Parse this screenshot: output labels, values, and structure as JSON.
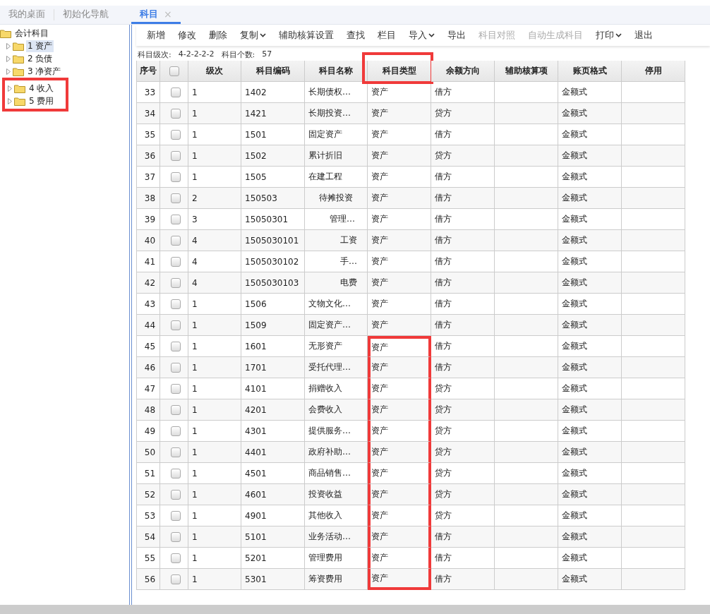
{
  "tabs": [
    {
      "label": "我的桌面",
      "selected": false
    },
    {
      "label": "初始化导航",
      "selected": false
    },
    {
      "label": "科目",
      "selected": true,
      "close": "×"
    }
  ],
  "sidebar": {
    "root": {
      "label": "会计科目",
      "children": [
        {
          "label": "1 资产",
          "selected": true,
          "highlighted": false
        },
        {
          "label": "2 负债",
          "selected": false,
          "highlighted": false
        },
        {
          "label": "3 净资产",
          "selected": false,
          "highlighted": false
        },
        {
          "label": "4 收入",
          "selected": false,
          "highlighted": true
        },
        {
          "label": "5 费用",
          "selected": false,
          "highlighted": true
        }
      ]
    }
  },
  "toolbar": [
    {
      "label": "新增",
      "dropdown": false,
      "disabled": false
    },
    {
      "label": "修改",
      "dropdown": false,
      "disabled": false
    },
    {
      "label": "删除",
      "dropdown": false,
      "disabled": false
    },
    {
      "label": "复制",
      "dropdown": true,
      "disabled": false
    },
    {
      "label": "辅助核算设置",
      "dropdown": false,
      "disabled": false
    },
    {
      "label": "查找",
      "dropdown": false,
      "disabled": false
    },
    {
      "label": "栏目",
      "dropdown": false,
      "disabled": false
    },
    {
      "label": "导入",
      "dropdown": true,
      "disabled": false
    },
    {
      "label": "导出",
      "dropdown": false,
      "disabled": false
    },
    {
      "label": "科目对照",
      "dropdown": false,
      "disabled": true
    },
    {
      "label": "自动生成科目",
      "dropdown": false,
      "disabled": true
    },
    {
      "label": "打印",
      "dropdown": true,
      "disabled": false
    },
    {
      "label": "退出",
      "dropdown": false,
      "disabled": false
    }
  ],
  "info": [
    {
      "label": "科目级次:",
      "value": "4-2-2-2-2"
    },
    {
      "label": "科目个数:",
      "value": "57"
    }
  ],
  "table": {
    "columns": [
      {
        "label": "序号",
        "kind": "index",
        "highlighted": false
      },
      {
        "kind": "check",
        "highlighted": false
      },
      {
        "label": "级次",
        "kind": "text",
        "highlighted": false
      },
      {
        "label": "科目编码",
        "kind": "text",
        "highlighted": false
      },
      {
        "label": "科目名称",
        "kind": "name",
        "highlighted": false
      },
      {
        "label": "科目类型",
        "kind": "text",
        "highlighted": true
      },
      {
        "label": "余额方向",
        "kind": "text",
        "highlighted": false
      },
      {
        "label": "辅助核算项",
        "kind": "text",
        "highlighted": false
      },
      {
        "label": "账页格式",
        "kind": "text",
        "highlighted": false
      },
      {
        "label": "停用",
        "kind": "text",
        "highlighted": false
      }
    ],
    "rows": [
      {
        "no": "33",
        "checked": false,
        "level": "1",
        "code": "1402",
        "name": "长期债权…",
        "type": "资产",
        "direction": "借方",
        "aux": "",
        "format": "金额式",
        "disabled_flag": "",
        "highlighted": false
      },
      {
        "no": "34",
        "checked": false,
        "level": "1",
        "code": "1421",
        "name": "长期投资…",
        "type": "资产",
        "direction": "贷方",
        "aux": "",
        "format": "金额式",
        "disabled_flag": "",
        "highlighted": false
      },
      {
        "no": "35",
        "checked": false,
        "level": "1",
        "code": "1501",
        "name": "固定资产",
        "type": "资产",
        "direction": "借方",
        "aux": "",
        "format": "金额式",
        "disabled_flag": "",
        "highlighted": false
      },
      {
        "no": "36",
        "checked": false,
        "level": "1",
        "code": "1502",
        "name": "累计折旧",
        "type": "资产",
        "direction": "贷方",
        "aux": "",
        "format": "金额式",
        "disabled_flag": "",
        "highlighted": false
      },
      {
        "no": "37",
        "checked": false,
        "level": "1",
        "code": "1505",
        "name": "在建工程",
        "type": "资产",
        "direction": "借方",
        "aux": "",
        "format": "金额式",
        "disabled_flag": "",
        "highlighted": false
      },
      {
        "no": "38",
        "checked": false,
        "level": "2",
        "code": "150503",
        "name": "待摊投资",
        "type": "资产",
        "direction": "借方",
        "aux": "",
        "format": "金额式",
        "disabled_flag": "",
        "highlighted": false
      },
      {
        "no": "39",
        "checked": false,
        "level": "3",
        "code": "15050301",
        "name": "管理…",
        "type": "资产",
        "direction": "借方",
        "aux": "",
        "format": "金额式",
        "disabled_flag": "",
        "highlighted": false
      },
      {
        "no": "40",
        "checked": false,
        "level": "4",
        "code": "1505030101",
        "name": "工资",
        "type": "资产",
        "direction": "借方",
        "aux": "",
        "format": "金额式",
        "disabled_flag": "",
        "highlighted": false
      },
      {
        "no": "41",
        "checked": false,
        "level": "4",
        "code": "1505030102",
        "name": "手…",
        "type": "资产",
        "direction": "借方",
        "aux": "",
        "format": "金额式",
        "disabled_flag": "",
        "highlighted": false
      },
      {
        "no": "42",
        "checked": false,
        "level": "4",
        "code": "1505030103",
        "name": "电费",
        "type": "资产",
        "direction": "借方",
        "aux": "",
        "format": "金额式",
        "disabled_flag": "",
        "highlighted": false
      },
      {
        "no": "43",
        "checked": false,
        "level": "1",
        "code": "1506",
        "name": "文物文化…",
        "type": "资产",
        "direction": "借方",
        "aux": "",
        "format": "金额式",
        "disabled_flag": "",
        "highlighted": false
      },
      {
        "no": "44",
        "checked": false,
        "level": "1",
        "code": "1509",
        "name": "固定资产…",
        "type": "资产",
        "direction": "借方",
        "aux": "",
        "format": "金额式",
        "disabled_flag": "",
        "highlighted": false
      },
      {
        "no": "45",
        "checked": false,
        "level": "1",
        "code": "1601",
        "name": "无形资产",
        "type": "资产",
        "direction": "借方",
        "aux": "",
        "format": "金额式",
        "disabled_flag": "",
        "highlighted": true
      },
      {
        "no": "46",
        "checked": false,
        "level": "1",
        "code": "1701",
        "name": "受托代理…",
        "type": "资产",
        "direction": "借方",
        "aux": "",
        "format": "金额式",
        "disabled_flag": "",
        "highlighted": true
      },
      {
        "no": "47",
        "checked": false,
        "level": "1",
        "code": "4101",
        "name": "捐赠收入",
        "type": "资产",
        "direction": "贷方",
        "aux": "",
        "format": "金额式",
        "disabled_flag": "",
        "highlighted": true
      },
      {
        "no": "48",
        "checked": false,
        "level": "1",
        "code": "4201",
        "name": "会费收入",
        "type": "资产",
        "direction": "贷方",
        "aux": "",
        "format": "金额式",
        "disabled_flag": "",
        "highlighted": true
      },
      {
        "no": "49",
        "checked": false,
        "level": "1",
        "code": "4301",
        "name": "提供服务…",
        "type": "资产",
        "direction": "贷方",
        "aux": "",
        "format": "金额式",
        "disabled_flag": "",
        "highlighted": true
      },
      {
        "no": "50",
        "checked": false,
        "level": "1",
        "code": "4401",
        "name": "政府补助…",
        "type": "资产",
        "direction": "贷方",
        "aux": "",
        "format": "金额式",
        "disabled_flag": "",
        "highlighted": true
      },
      {
        "no": "51",
        "checked": false,
        "level": "1",
        "code": "4501",
        "name": "商品销售…",
        "type": "资产",
        "direction": "贷方",
        "aux": "",
        "format": "金额式",
        "disabled_flag": "",
        "highlighted": true
      },
      {
        "no": "52",
        "checked": false,
        "level": "1",
        "code": "4601",
        "name": "投资收益",
        "type": "资产",
        "direction": "贷方",
        "aux": "",
        "format": "金额式",
        "disabled_flag": "",
        "highlighted": true
      },
      {
        "no": "53",
        "checked": false,
        "level": "1",
        "code": "4901",
        "name": "其他收入",
        "type": "资产",
        "direction": "贷方",
        "aux": "",
        "format": "金额式",
        "disabled_flag": "",
        "highlighted": true
      },
      {
        "no": "54",
        "checked": false,
        "level": "1",
        "code": "5101",
        "name": "业务活动…",
        "type": "资产",
        "direction": "借方",
        "aux": "",
        "format": "金额式",
        "disabled_flag": "",
        "highlighted": true
      },
      {
        "no": "55",
        "checked": false,
        "level": "1",
        "code": "5201",
        "name": "管理费用",
        "type": "资产",
        "direction": "借方",
        "aux": "",
        "format": "金额式",
        "disabled_flag": "",
        "highlighted": true
      },
      {
        "no": "56",
        "checked": false,
        "level": "1",
        "code": "5301",
        "name": "筹资费用",
        "type": "资产",
        "direction": "借方",
        "aux": "",
        "format": "金额式",
        "disabled_flag": "",
        "highlighted": true
      }
    ]
  }
}
